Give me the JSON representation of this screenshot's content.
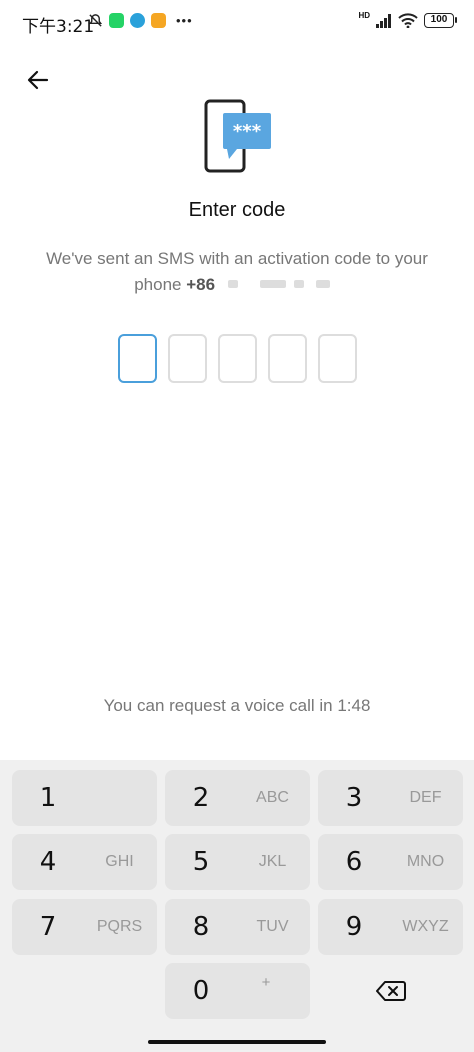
{
  "status_bar": {
    "time": "下午3:21",
    "battery": "100",
    "network_label": "HD",
    "icons": [
      "bell-mute-icon",
      "whatsapp-icon",
      "telegram-icon",
      "message-app-icon",
      "more-dots-icon",
      "signal-icon",
      "wifi-icon",
      "battery-icon"
    ],
    "colors": {
      "whatsapp": "#25D366",
      "telegram": "#2AA1DA",
      "message_app": "#F5A623"
    }
  },
  "header": {
    "back_icon": "back-arrow-icon"
  },
  "content": {
    "title": "Enter code",
    "subtitle_line1": "We've sent an SMS with an activation code to your",
    "subtitle_prefix": "phone",
    "phone_code": "+86",
    "code_boxes": [
      "",
      "",
      "",
      "",
      ""
    ],
    "voice_call_text": "You can request a voice call in 1:48"
  },
  "keypad": {
    "keys": [
      {
        "digit": "1",
        "letters": ""
      },
      {
        "digit": "2",
        "letters": "ABC"
      },
      {
        "digit": "3",
        "letters": "DEF"
      },
      {
        "digit": "4",
        "letters": "GHI"
      },
      {
        "digit": "5",
        "letters": "JKL"
      },
      {
        "digit": "6",
        "letters": "MNO"
      },
      {
        "digit": "7",
        "letters": "PQRS"
      },
      {
        "digit": "8",
        "letters": "TUV"
      },
      {
        "digit": "9",
        "letters": "WXYZ"
      },
      {
        "digit": "0",
        "letters": "+"
      }
    ],
    "backspace_icon": "backspace-icon"
  },
  "colors": {
    "accent": "#4A9FDB",
    "phone_bubble": "#5AA6E0"
  }
}
